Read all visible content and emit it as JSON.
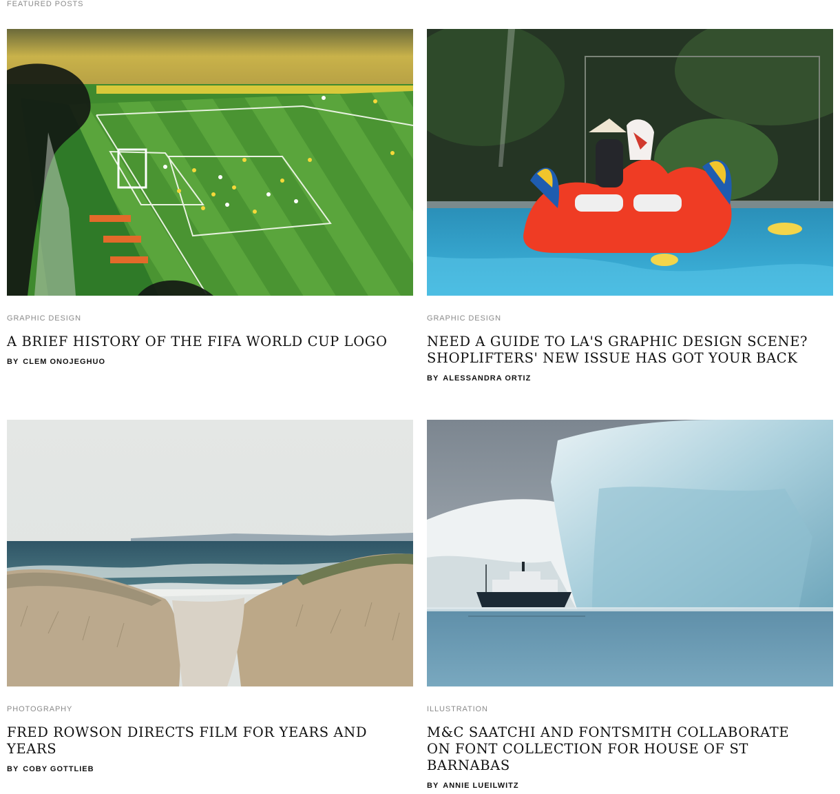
{
  "section": {
    "label": "FEATURED POSTS"
  },
  "posts": [
    {
      "category": "GRAPHIC DESIGN",
      "title": "A BRIEF HISTORY OF THE FIFA WORLD CUP LOGO",
      "by": "BY",
      "author": "CLEM ONOJEGHUO",
      "image": "stadium-football-photo"
    },
    {
      "category": "GRAPHIC DESIGN",
      "title": "NEED A GUIDE TO LA'S GRAPHIC DESIGN SCENE? SHOPLIFTERS' NEW ISSUE HAS GOT YOUR BACK",
      "by": "BY",
      "author": "ALESSANDRA ORTIZ",
      "image": "pool-inflatable-photo"
    },
    {
      "category": "PHOTOGRAPHY",
      "title": "FRED ROWSON DIRECTS FILM FOR YEARS AND YEARS",
      "by": "BY",
      "author": "COBY GOTTLIEB",
      "image": "beach-dunes-photo"
    },
    {
      "category": "ILLUSTRATION",
      "title": "M&C SAATCHI AND FONTSMITH COLLABORATE ON FONT COLLECTION FOR HOUSE OF ST BARNABAS",
      "by": "BY",
      "author": "ANNIE LUEILWITZ",
      "image": "iceberg-ship-photo"
    }
  ]
}
